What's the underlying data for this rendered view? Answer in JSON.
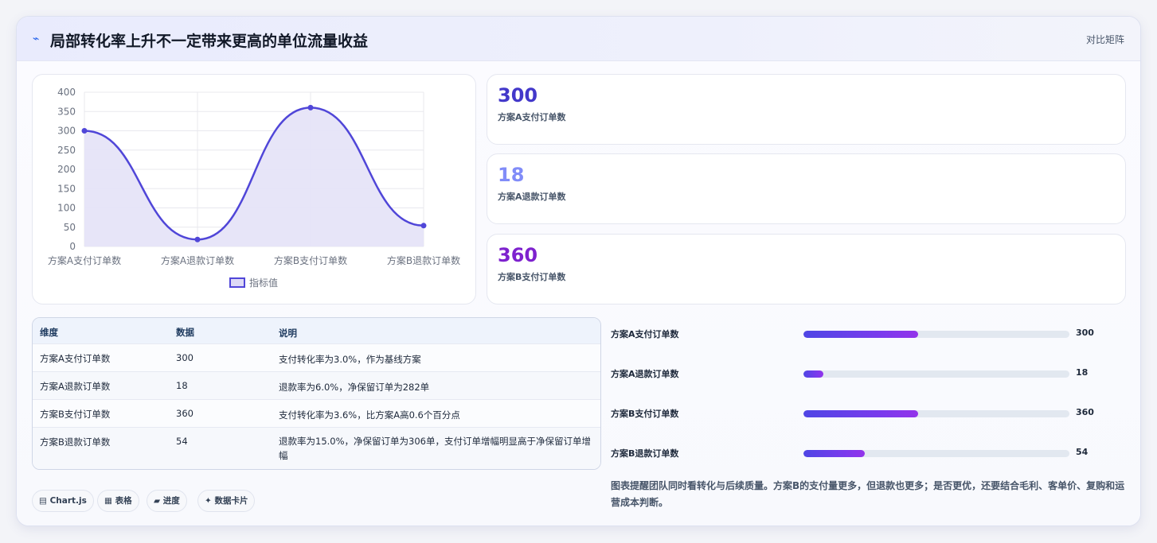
{
  "header": {
    "icon": "sparkline-icon",
    "title": "局部转化率上升不一定带来更高的单位流量收益",
    "link": "对比矩阵"
  },
  "chart_data": {
    "type": "line",
    "categories": [
      "方案A支付订单数",
      "方案A退款订单数",
      "方案B支付订单数",
      "方案B退款订单数"
    ],
    "series": [
      {
        "name": "指标值",
        "values": [
          300,
          18,
          360,
          54
        ]
      }
    ],
    "ylim": [
      0,
      400
    ],
    "yticks": [
      0,
      50,
      100,
      150,
      200,
      250,
      300,
      350,
      400
    ],
    "legend": "bottom",
    "grid": true,
    "color": "#5046d8",
    "fill": "#e6e4f8"
  },
  "stats": [
    {
      "value": "300",
      "label": "方案A支付订单数",
      "color": "#4338ca"
    },
    {
      "value": "18",
      "label": "方案A退款订单数",
      "color": "#818cf8"
    },
    {
      "value": "360",
      "label": "方案B支付订单数",
      "color": "#7e22ce"
    }
  ],
  "table": {
    "headers": [
      "维度",
      "数据",
      "说明"
    ],
    "rows": [
      [
        "方案A支付订单数",
        "300",
        "支付转化率为3.0%，作为基线方案"
      ],
      [
        "方案A退款订单数",
        "18",
        "退款率为6.0%，净保留订单为282单"
      ],
      [
        "方案B支付订单数",
        "360",
        "支付转化率为3.6%，比方案A高0.6个百分点"
      ],
      [
        "方案B退款订单数",
        "54",
        "退款率为15.0%，净保留订单为306单，支付订单增幅明显高于净保留订单增幅"
      ]
    ]
  },
  "pills": [
    {
      "icon": "▤",
      "label": "Chart.js"
    },
    {
      "icon": "▦",
      "label": "表格"
    },
    {
      "icon": "▰",
      "label": "进度"
    },
    {
      "icon": "✦",
      "label": "数据卡片"
    }
  ],
  "progress": [
    {
      "label": "方案A支付订单数",
      "value": "300",
      "fraction": 0.43
    },
    {
      "label": "方案A退款订单数",
      "value": "18",
      "fraction": 0.075
    },
    {
      "label": "方案B支付订单数",
      "value": "360",
      "fraction": 0.43
    },
    {
      "label": "方案B退款订单数",
      "value": "54",
      "fraction": 0.23
    }
  ],
  "note": "图表提醒团队同时看转化与后续质量。方案B的支付量更多，但退款也更多；是否更优，还要结合毛利、客单价、复购和运营成本判断。"
}
